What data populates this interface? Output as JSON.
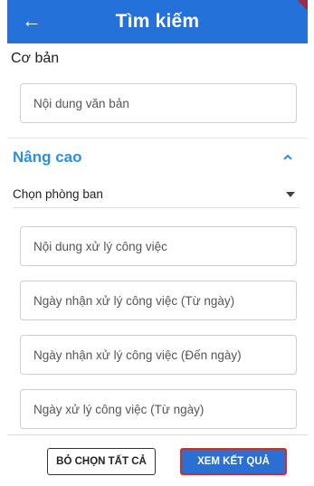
{
  "header": {
    "title": "Tìm kiếm",
    "back_icon": "arrow-left-icon",
    "background": "#2472d9"
  },
  "basic": {
    "label": "Cơ bản",
    "content_placeholder": "Nội dung văn bản"
  },
  "advanced": {
    "label": "Nâng cao",
    "label_color": "#2d8fe0",
    "toggle_icon": "chevron-up-icon",
    "department_select": "Chọn phòng ban",
    "fields": [
      "Nội dung xử lý công việc",
      "Ngày nhận xử lý công việc (Từ ngày)",
      "Ngày nhận xử lý công việc (Đến ngày)",
      "Ngày xử lý công việc (Từ ngày)"
    ]
  },
  "actions": {
    "clear_label": "BỎ CHỌN TẤT CẢ",
    "submit_label": "XEM KẾT QUẢ",
    "submit_color": "#2a6fd1",
    "highlight_color": "#d92a2a"
  }
}
